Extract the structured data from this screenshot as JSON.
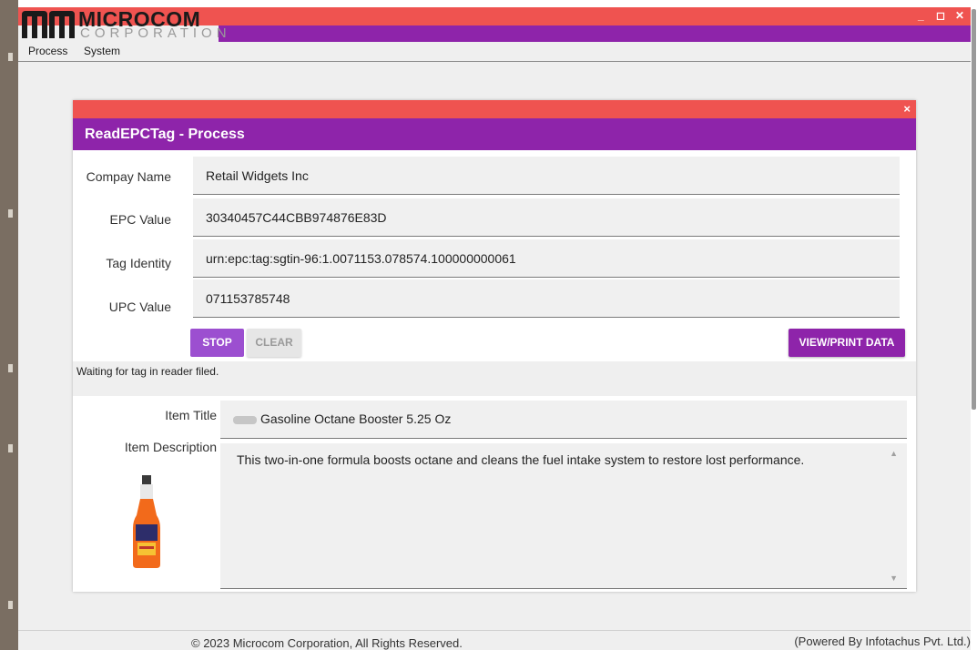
{
  "app": {
    "logo_name": "MICROCOM",
    "logo_sub": "CORPORATION",
    "window_controls": {
      "minimize": "_",
      "maximize": "◻",
      "close": "✕"
    }
  },
  "menu": {
    "items": [
      "Process",
      "System"
    ]
  },
  "dialog": {
    "title": "ReadEPCTag - Process",
    "close": "×",
    "fields": {
      "company_name": {
        "label": "Compay Name",
        "value": "Retail Widgets Inc"
      },
      "epc_value": {
        "label": "EPC Value",
        "value": "30340457C44CBB974876E83D"
      },
      "tag_identity": {
        "label": "Tag Identity",
        "value": "urn:epc:tag:sgtin-96:1.0071153.078574.100000000061"
      },
      "upc_value": {
        "label": "UPC Value",
        "value": "071153785748"
      }
    },
    "buttons": {
      "stop": "STOP",
      "clear": "CLEAR",
      "view_print": "VIEW/PRINT DATA"
    },
    "status": "Waiting for tag in reader filed.",
    "item": {
      "title_label": "Item Title",
      "title_value": "Gasoline Octane Booster 5.25 Oz",
      "description_label": "Item Description",
      "description_value": "This two-in-one formula boosts octane and cleans the fuel intake system to restore lost performance."
    }
  },
  "footer": {
    "copyright": "© 2023 Microcom Corporation, All Rights Reserved.",
    "powered_by": "(Powered By Infotachus Pvt. Ltd.)"
  },
  "colors": {
    "accent_red": "#ef5350",
    "accent_purple": "#8e24aa",
    "button_purple": "#9c4fd0"
  }
}
